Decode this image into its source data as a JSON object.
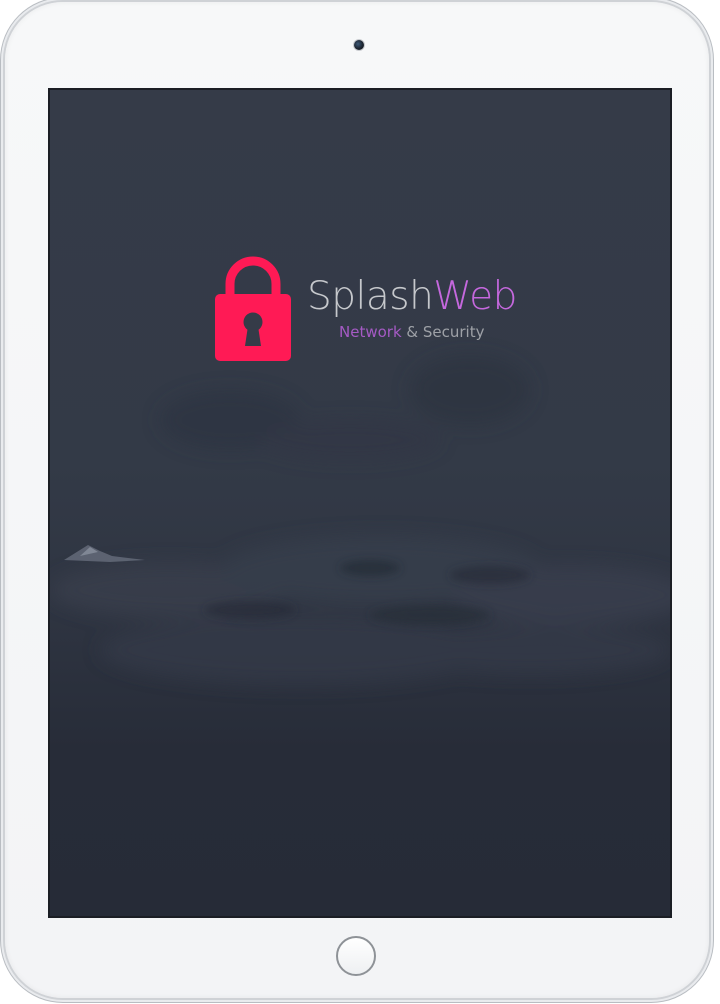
{
  "device": {
    "type": "tablet",
    "camera_icon": "camera-icon",
    "home_button_icon": "home-button-icon"
  },
  "splash": {
    "logo_icon": "padlock-icon",
    "brand_part1": "Splash",
    "brand_part2": "Web",
    "tagline_part1": "Network",
    "tagline_part2": " & Security"
  },
  "colors": {
    "lock": "#ff1a55",
    "brand_text": "#c6c8cc",
    "brand_accent": "#c568de",
    "tagline_accent": "#a55ac4",
    "background_top": "#353b48",
    "background_bottom": "#262b37"
  }
}
